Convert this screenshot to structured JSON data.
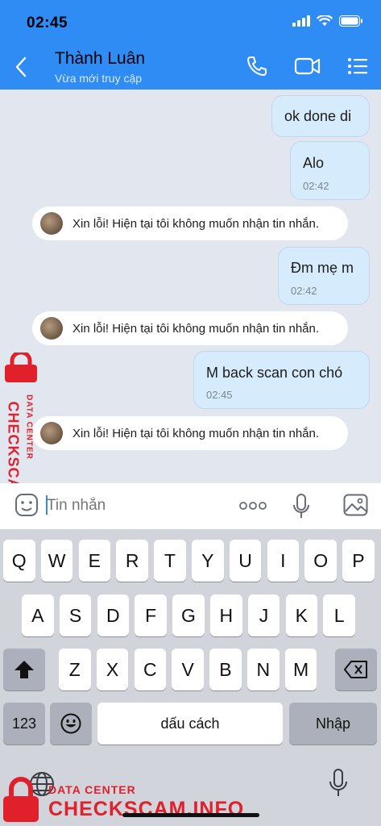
{
  "status_bar": {
    "time": "02:45"
  },
  "header": {
    "contact_name": "Thành Luân",
    "contact_status": "Vừa mới truy cập"
  },
  "messages": [
    {
      "text": "ok done di",
      "time": ""
    },
    {
      "text": "Alo",
      "time": "02:42"
    },
    {
      "text": "Xin lỗi! Hiện tại tôi không muốn nhận tin nhắn."
    },
    {
      "text": "Đm mẹ m",
      "time": "02:42"
    },
    {
      "text": "Xin lỗi! Hiện tại tôi không muốn nhận tin nhắn."
    },
    {
      "text": "M back scan con chó",
      "time": "02:45"
    },
    {
      "text": "Xin lỗi! Hiện tại tôi không muốn nhận tin nhắn."
    }
  ],
  "input": {
    "placeholder": "Tin nhắn"
  },
  "keyboard": {
    "row1": [
      "Q",
      "W",
      "E",
      "R",
      "T",
      "Y",
      "U",
      "I",
      "O",
      "P"
    ],
    "row2": [
      "A",
      "S",
      "D",
      "F",
      "G",
      "H",
      "J",
      "K",
      "L"
    ],
    "row3": [
      "Z",
      "X",
      "C",
      "V",
      "B",
      "N",
      "M"
    ],
    "numbers_key": "123",
    "space_key": "dấu cách",
    "return_key": "Nhập"
  },
  "watermark": {
    "side_small": "DATA CENTER",
    "side_big": "CHECKSCAM.INFO",
    "bottom_small": "DATA CENTER",
    "bottom_big": "CHECKSCAM.INFO"
  },
  "colors": {
    "accent": "#2f8cf5",
    "outgoing_bubble": "#d6ecfd",
    "watermark": "#e0202b"
  }
}
